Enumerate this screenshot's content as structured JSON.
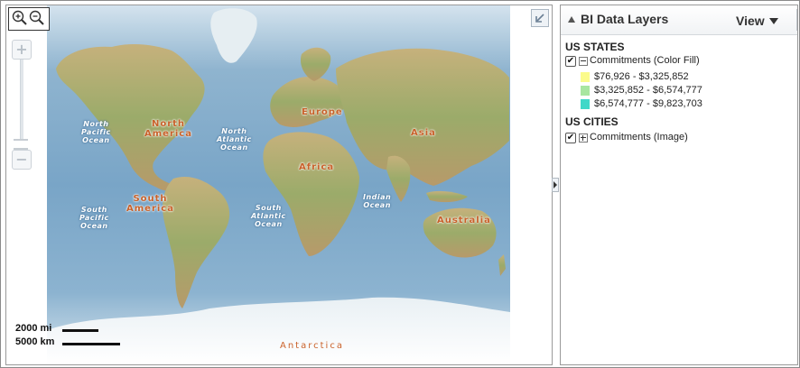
{
  "map": {
    "ocean_labels": [
      {
        "lines": [
          "North",
          "Pacific",
          "Ocean"
        ]
      },
      {
        "lines": [
          "North",
          "Atlantic",
          "Ocean"
        ]
      },
      {
        "lines": [
          "South",
          "Pacific",
          "Ocean"
        ]
      },
      {
        "lines": [
          "South",
          "Atlantic",
          "Ocean"
        ]
      },
      {
        "lines": [
          "Indian",
          "Ocean"
        ]
      }
    ],
    "land_labels": [
      {
        "lines": [
          "North",
          "America"
        ]
      },
      {
        "lines": [
          "Europe"
        ]
      },
      {
        "lines": [
          "Asia"
        ]
      },
      {
        "lines": [
          "Africa"
        ]
      },
      {
        "lines": [
          "South",
          "America"
        ]
      },
      {
        "lines": [
          "Australia"
        ]
      },
      {
        "lines": [
          "Antarctica"
        ]
      }
    ],
    "scale": {
      "miles": "2000 mi",
      "km": "5000 km"
    },
    "controls": {
      "zoom_in_icon": "zoom-in-magnifier",
      "zoom_out_icon": "zoom-out-magnifier",
      "pan_in": "+",
      "pan_out": "−",
      "overview_icon": "arrow-down-left"
    }
  },
  "layers_panel": {
    "title": "BI Data Layers",
    "view_menu": "View",
    "sections": [
      {
        "title": "US STATES",
        "layer": {
          "label": "Commitments (Color Fill)",
          "checked": true,
          "expanded": true
        },
        "legend": [
          {
            "label": "$76,926 - $3,325,852",
            "color": "#fbfb8c"
          },
          {
            "label": "$3,325,852 - $6,574,777",
            "color": "#a8e6a0"
          },
          {
            "label": "$6,574,777 - $9,823,703",
            "color": "#40d8c8"
          }
        ]
      },
      {
        "title": "US CITIES",
        "layer": {
          "label": "Commitments (Image)",
          "checked": true,
          "expanded": false
        }
      }
    ]
  },
  "colors": {
    "ocean": "#79a5c7",
    "land": "#b9a46f",
    "land_label": "#c8612a"
  }
}
